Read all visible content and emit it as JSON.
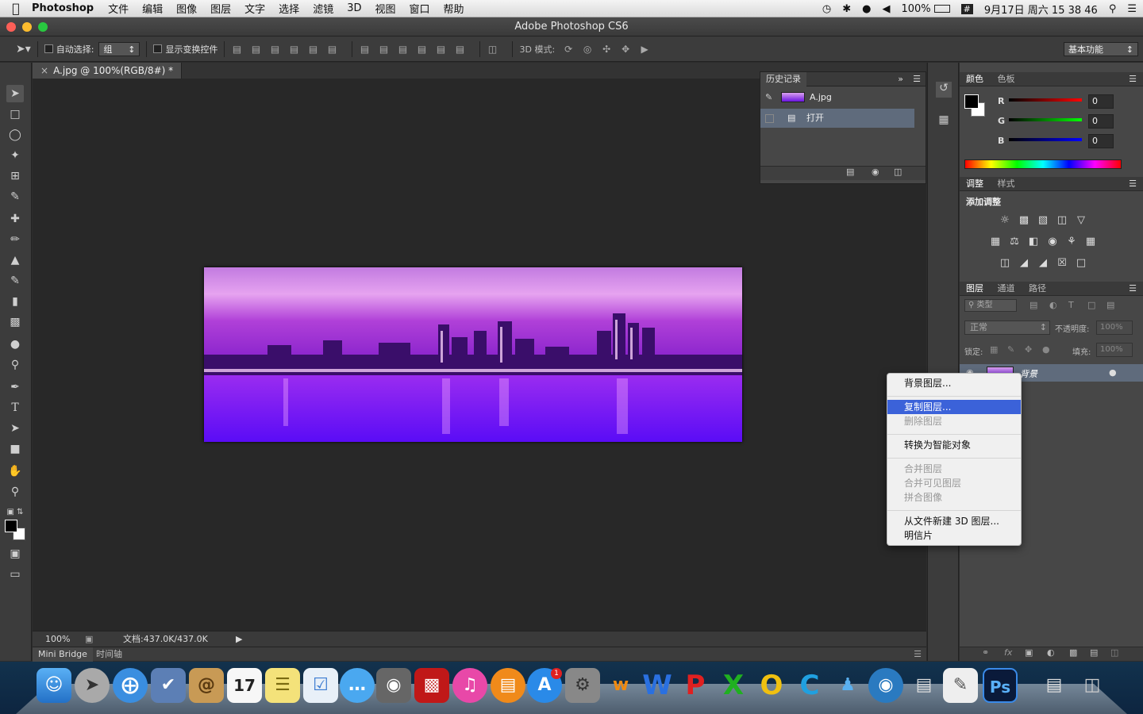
{
  "menubar": {
    "app_name": "Photoshop",
    "items": [
      "文件",
      "编辑",
      "图像",
      "图层",
      "文字",
      "选择",
      "滤镜",
      "3D",
      "视图",
      "窗口",
      "帮助"
    ],
    "battery": "100%",
    "datetime": "9月17日 周六 15 38 46"
  },
  "window": {
    "title": "Adobe Photoshop CS6"
  },
  "options_bar": {
    "auto_select_label": "自动选择:",
    "auto_select_value": "组",
    "show_transform_label": "显示变换控件",
    "mode_3d_label": "3D 模式:",
    "workspace": "基本功能"
  },
  "document": {
    "tab_title": "A.jpg @ 100%(RGB/8#) *",
    "zoom": "100%",
    "doc_size": "文档:437.0K/437.0K"
  },
  "bottom_tabs": [
    "Mini Bridge",
    "时间轴"
  ],
  "history": {
    "tab": "历史记录",
    "snapshot": "A.jpg",
    "steps": [
      "打开"
    ]
  },
  "color_panel": {
    "tabs": [
      "颜色",
      "色板"
    ],
    "channels": [
      {
        "label": "R",
        "value": "0"
      },
      {
        "label": "G",
        "value": "0"
      },
      {
        "label": "B",
        "value": "0"
      }
    ]
  },
  "adjustments_panel": {
    "tabs": [
      "调整",
      "样式"
    ],
    "heading": "添加调整"
  },
  "layers_panel": {
    "tabs": [
      "图层",
      "通道",
      "路径"
    ],
    "filter": "类型",
    "blend_mode": "正常",
    "opacity_label": "不透明度:",
    "opacity_value": "100%",
    "lock_label": "锁定:",
    "fill_label": "填充:",
    "fill_value": "100%",
    "layer_name": "背景"
  },
  "context_menu": {
    "items": [
      {
        "label": "背景图层...",
        "enabled": true
      },
      {
        "label": "复制图层...",
        "enabled": true,
        "highlighted": true
      },
      {
        "label": "删除图层",
        "enabled": false
      },
      {
        "label": "转换为智能对象",
        "enabled": true
      },
      {
        "label": "合并图层",
        "enabled": false
      },
      {
        "label": "合并可见图层",
        "enabled": false
      },
      {
        "label": "拼合图像",
        "enabled": false
      },
      {
        "label": "从文件新建 3D 图层...",
        "enabled": true
      },
      {
        "label": "明信片",
        "enabled": true
      }
    ]
  },
  "dock": {
    "badge": "1",
    "ps_label": "Ps",
    "calendar_day": "17"
  }
}
